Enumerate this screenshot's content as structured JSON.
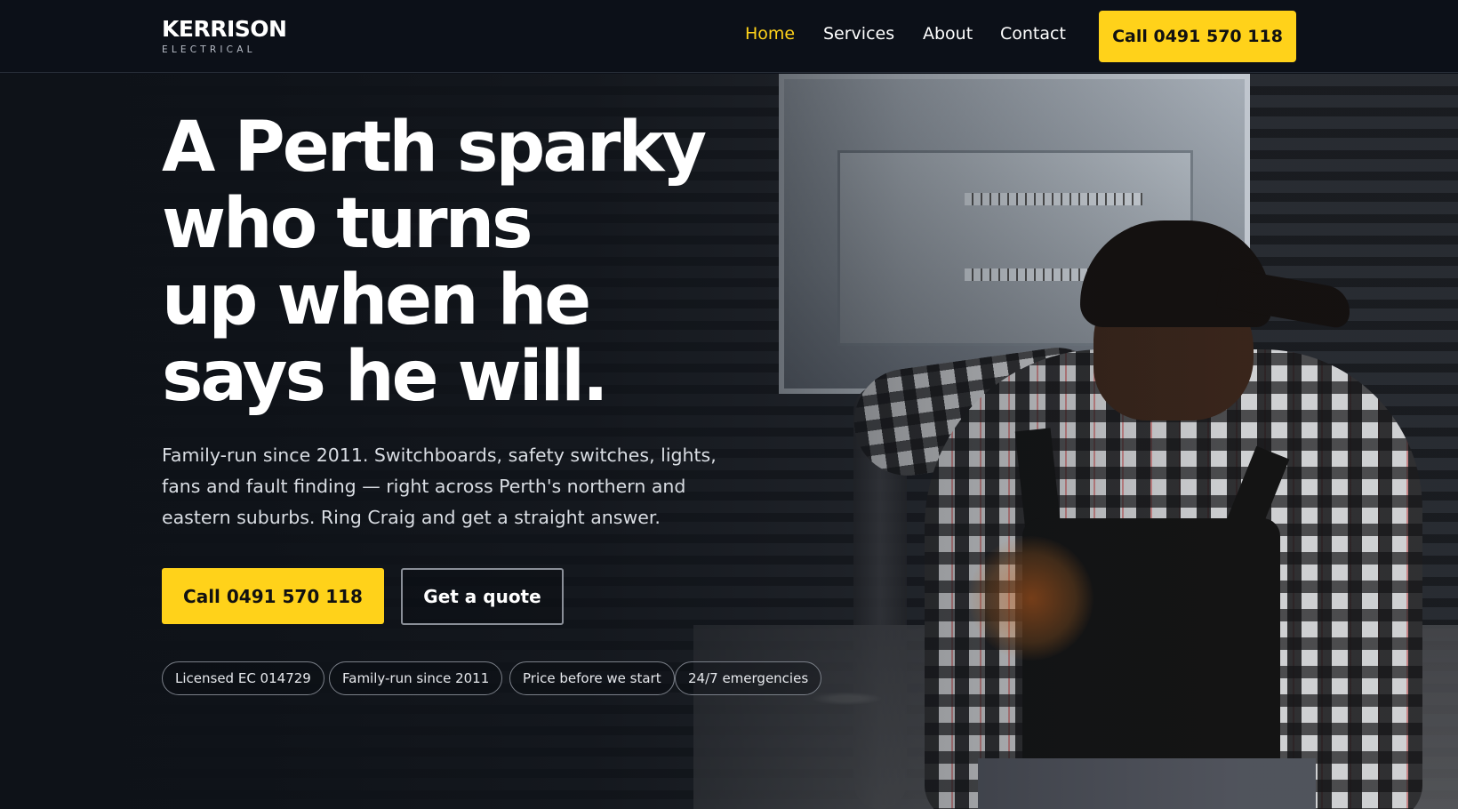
{
  "brand": {
    "name": "KERRISON",
    "tagline": "ELECTRICAL"
  },
  "nav": {
    "links": [
      {
        "label": "Home",
        "active": true
      },
      {
        "label": "Services",
        "active": false
      },
      {
        "label": "About",
        "active": false
      },
      {
        "label": "Contact",
        "active": false
      }
    ],
    "call_label": "Call 0491 570 118"
  },
  "hero": {
    "headline_lines": [
      "A Perth sparky",
      "who turns",
      "up when he",
      "says he will."
    ],
    "lede": "Family-run since 2011. Switchboards, safety switches, lights, fans and fault finding — right across Perth's northern and eastern suburbs. Ring Craig and get a straight answer.",
    "primary_cta": "Call 0491 570 118",
    "secondary_cta": "Get a quote",
    "badges": [
      "Licensed EC 014729",
      "Family-run since 2011",
      "Price before we start",
      "24/7 emergencies"
    ]
  },
  "colors": {
    "accent": "#ffd21a",
    "nav_background": "#0c1018",
    "text": "#ffffff"
  },
  "icons": []
}
